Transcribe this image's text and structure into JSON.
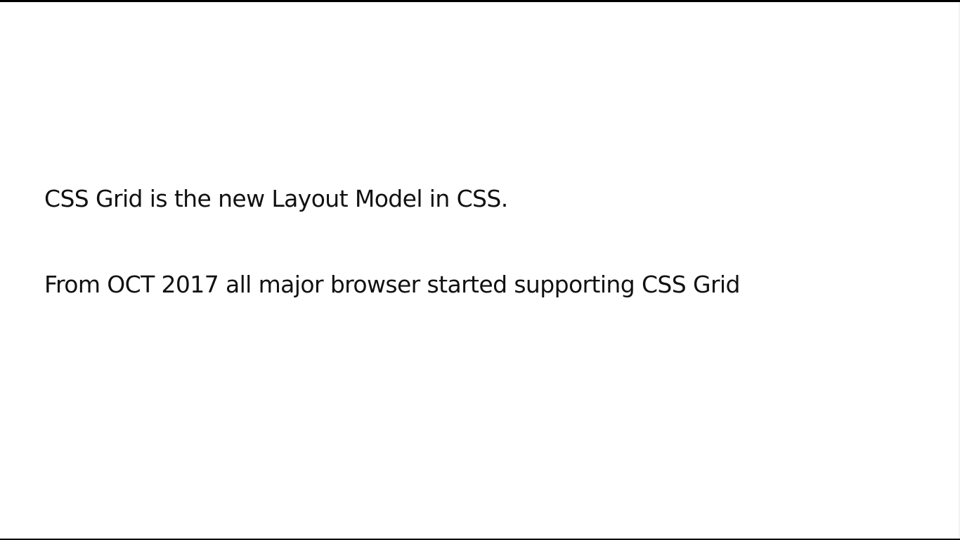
{
  "slide": {
    "lines": [
      "CSS Grid is the new Layout Model in CSS.",
      "From OCT 2017 all major browser started supporting CSS Grid"
    ]
  },
  "colors": {
    "background": "#ffffff",
    "frame": "#000000",
    "text": "#111111"
  }
}
